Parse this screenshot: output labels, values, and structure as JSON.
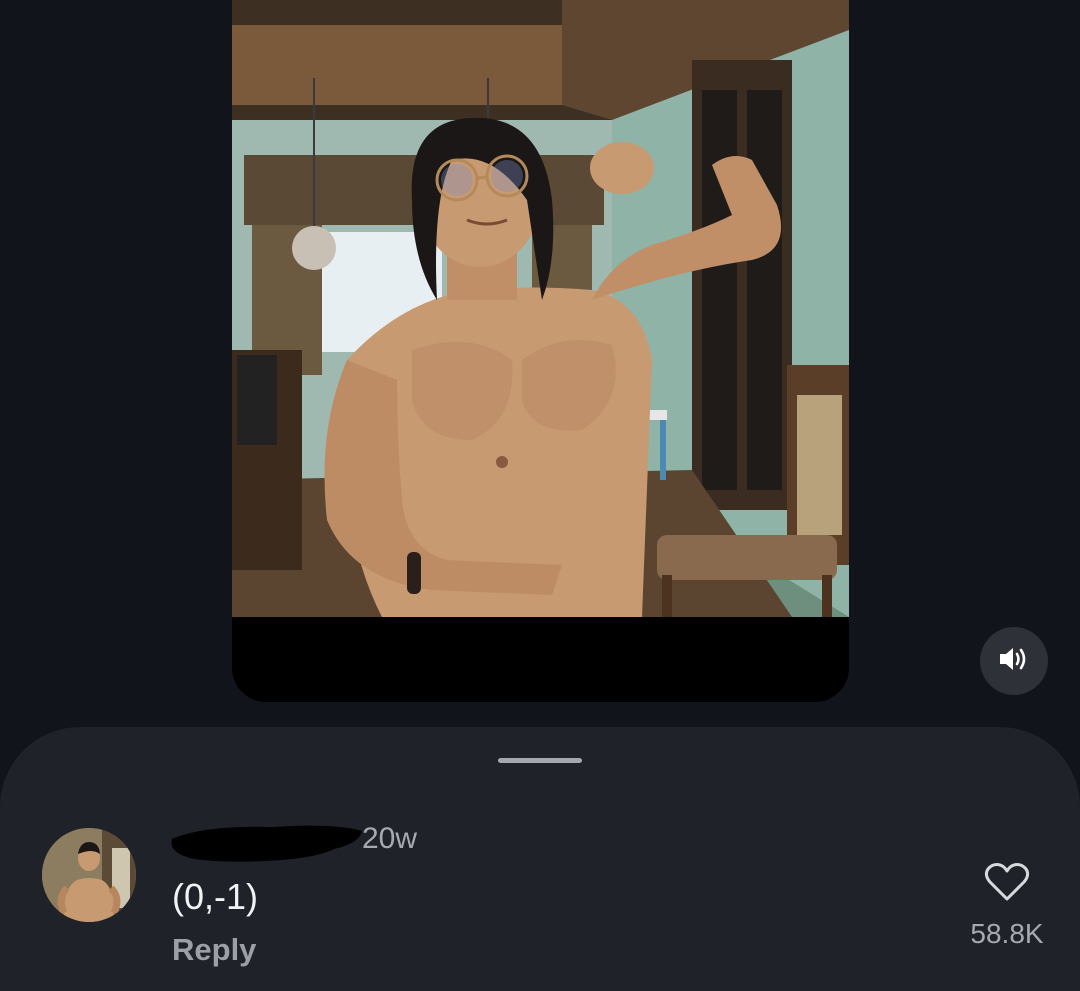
{
  "video": {
    "content": "video frame"
  },
  "sound": {
    "icon": "speaker-volume-icon"
  },
  "comment": {
    "time": "20w",
    "text": "(0,-1)",
    "reply_label": "Reply",
    "like_icon": "heart-outline-icon",
    "like_count": "58.8K"
  },
  "colors": {
    "background": "#11141b",
    "sheet": "#1f2228",
    "text_primary": "#f2f3f5",
    "text_secondary": "#a6a9b0"
  }
}
